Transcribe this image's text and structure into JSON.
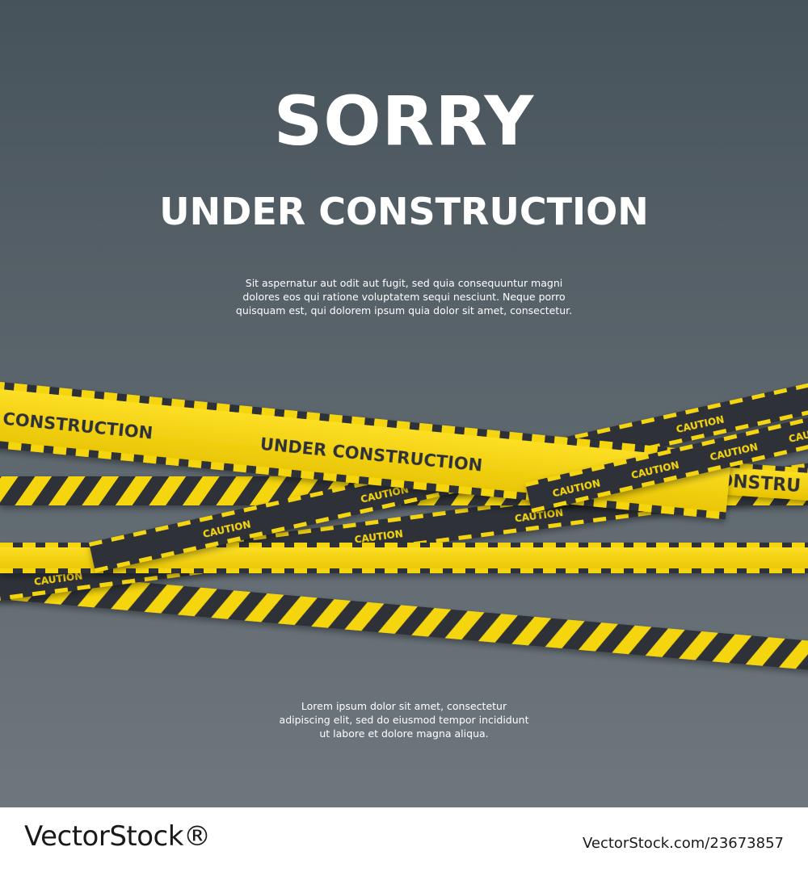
{
  "headline": "SORRY",
  "subheadline": "UNDER CONSTRUCTION",
  "intro_text": [
    "Sit aspernatur aut odit aut fugit, sed quia consequuntur magni",
    "dolores eos qui ratione voluptatem sequi nesciunt. Neque porro",
    "quisquam est, qui dolorem ipsum quia dolor sit amet, consectetur."
  ],
  "outro_text": [
    "Lorem ipsum dolor sit amet, consectetur",
    "adipiscing elit, sed do eiusmod tempor incididunt",
    "ut labore et dolore magna aliqua."
  ],
  "tapes": {
    "big_tape": [
      "CONSTRUCTION",
      "UNDER CONSTRUCTION"
    ],
    "right_fragment": "CONSTRU",
    "caution_word": "CAUTION"
  },
  "colors": {
    "tape_yellow": "#f5d50a",
    "tape_dark": "#2f3338",
    "background": "#5a646b"
  },
  "watermark": {
    "brand": "VectorStock®",
    "image_id": "VectorStock.com/23673857"
  }
}
